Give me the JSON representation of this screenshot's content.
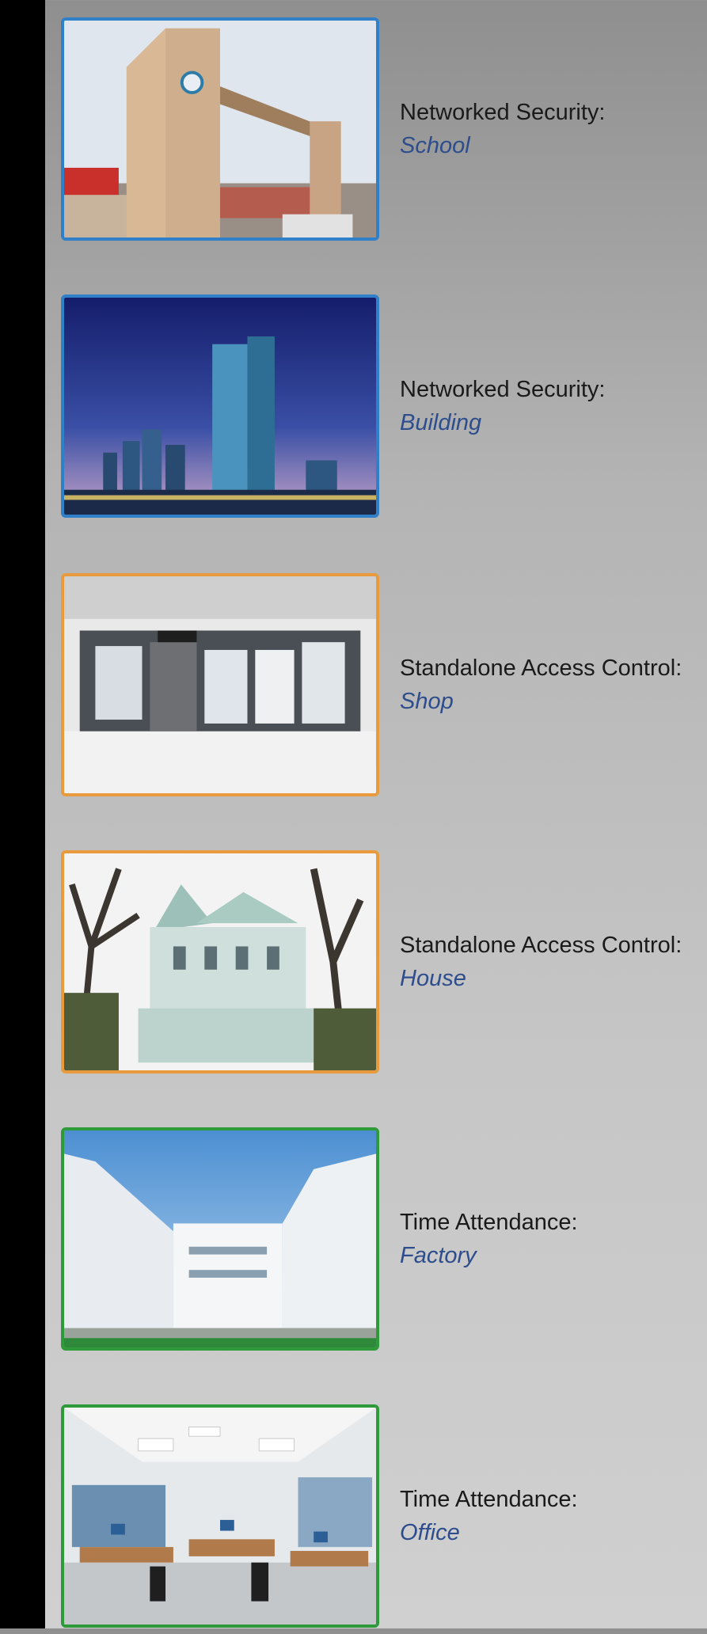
{
  "items": [
    {
      "category": "Networked Security:",
      "subject": "School",
      "frame_color": "#2f80c8",
      "image": "school-photo"
    },
    {
      "category": "Networked Security:",
      "subject": "Building",
      "frame_color": "#2f80c8",
      "image": "building-photo"
    },
    {
      "category": "Standalone Access Control:",
      "subject": "Shop",
      "frame_color": "#e89a3c",
      "image": "shop-photo"
    },
    {
      "category": "Standalone Access Control:",
      "subject": "House",
      "frame_color": "#e89a3c",
      "image": "house-photo"
    },
    {
      "category": "Time Attendance:",
      "subject": "Factory",
      "frame_color": "#2e9a3a",
      "image": "factory-photo"
    },
    {
      "category": "Time Attendance:",
      "subject": "Office",
      "frame_color": "#2e9a3a",
      "image": "office-photo"
    }
  ]
}
